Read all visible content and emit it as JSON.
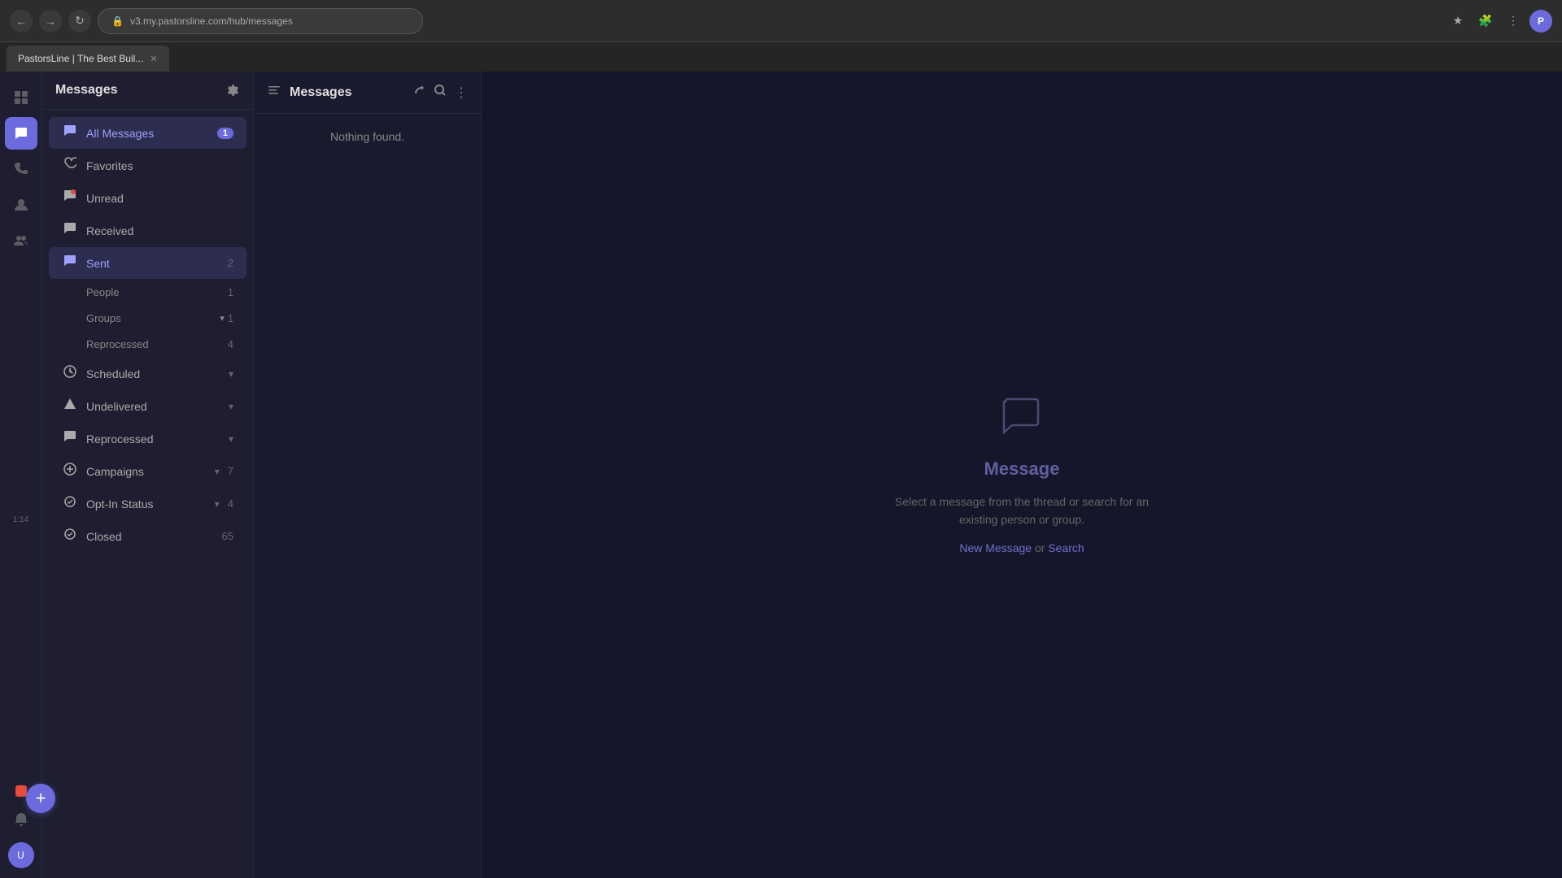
{
  "browser": {
    "back": "←",
    "forward": "→",
    "refresh": "↻",
    "url": "v3.my.pastorsline.com/hub/messages",
    "tab_label": "PastorsLine | The Best Buil...",
    "lock_icon": "🔒"
  },
  "left_nav": {
    "time": "1:14",
    "items": [
      {
        "id": "grid",
        "icon": "⊞",
        "active": false
      },
      {
        "id": "message",
        "icon": "💬",
        "active": true
      },
      {
        "id": "phone",
        "icon": "📞",
        "active": false
      },
      {
        "id": "person",
        "icon": "👤",
        "active": false
      },
      {
        "id": "group",
        "icon": "👥",
        "active": false
      }
    ]
  },
  "sidebar": {
    "title": "Messages",
    "items": [
      {
        "id": "all-messages",
        "icon": "💬",
        "label": "All Messages",
        "badge": "1",
        "active": true
      },
      {
        "id": "favorites",
        "icon": "♡",
        "label": "Favorites",
        "count": ""
      },
      {
        "id": "unread",
        "icon": "💬",
        "label": "Unread",
        "count": ""
      },
      {
        "id": "received",
        "icon": "💬",
        "label": "Received",
        "count": ""
      },
      {
        "id": "sent",
        "icon": "💬",
        "label": "Sent",
        "count": "2"
      },
      {
        "id": "scheduled",
        "icon": "🕐",
        "label": "Scheduled",
        "chevron": true
      },
      {
        "id": "undelivered",
        "icon": "⚠",
        "label": "Undelivered",
        "chevron": true
      },
      {
        "id": "reprocessed",
        "icon": "🔄",
        "label": "Reprocessed",
        "chevron": true
      },
      {
        "id": "campaigns",
        "icon": "➕",
        "label": "Campaigns",
        "count": "7",
        "chevron": true
      },
      {
        "id": "opt-in-status",
        "icon": "🛡",
        "label": "Opt-In Status",
        "count": "4",
        "chevron": true
      },
      {
        "id": "closed",
        "icon": "✅",
        "label": "Closed",
        "count": "65"
      }
    ],
    "sent_sub_items": [
      {
        "id": "people",
        "label": "People",
        "count": "1"
      },
      {
        "id": "groups",
        "label": "Groups",
        "chevron": true,
        "count": "1"
      },
      {
        "id": "reprocessed",
        "label": "Reprocessed",
        "count": "4"
      }
    ]
  },
  "message_panel": {
    "title": "Messages",
    "nothing_found": "Nothing found."
  },
  "main": {
    "icon": "💬",
    "title": "Message",
    "description": "Select a message from the thread or search for an\nexisting person or group.",
    "new_message_link": "New Message",
    "or_text": "or",
    "search_link": "Search"
  },
  "fab": {
    "icon": "+"
  }
}
